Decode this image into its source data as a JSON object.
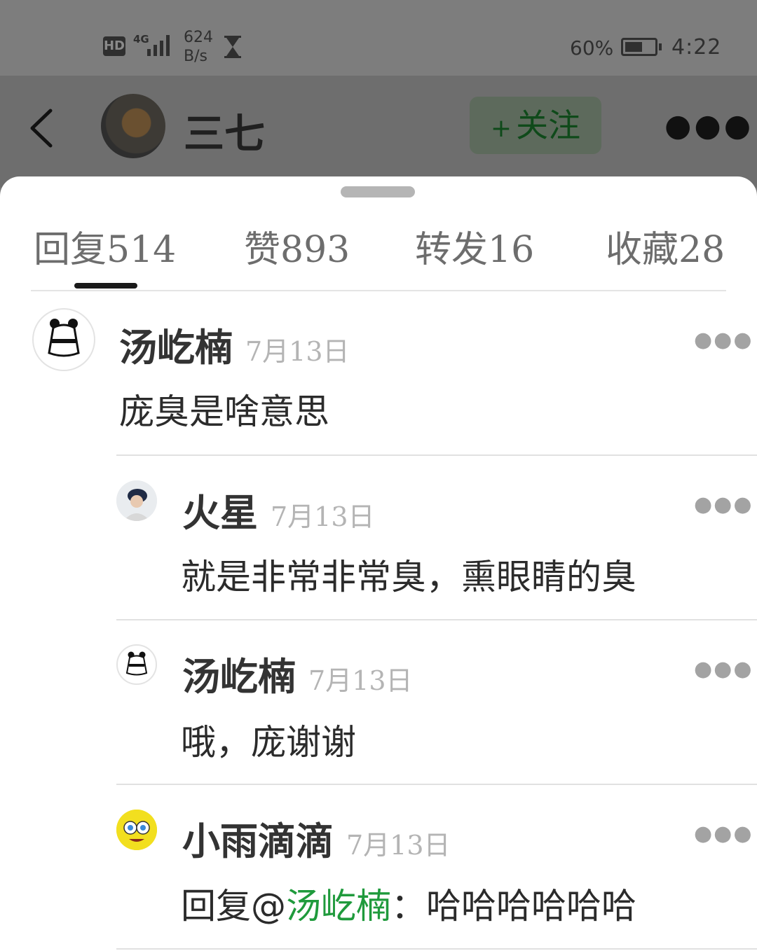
{
  "status_bar": {
    "hd": "HD",
    "network": "4G",
    "speed_value": "624",
    "speed_unit": "B/s",
    "battery_pct": "60%",
    "battery_level": 0.6,
    "time": "4:22"
  },
  "header": {
    "user_name": "三七",
    "follow_plus": "+",
    "follow_label": "关注",
    "more_icon": "more-dots-icon"
  },
  "tabs": [
    {
      "label": "回复",
      "count": "514"
    },
    {
      "label": "赞",
      "count": "893"
    },
    {
      "label": "转发",
      "count": "16"
    },
    {
      "label": "收藏",
      "count": "28"
    }
  ],
  "comments": [
    {
      "user": "汤屹楠",
      "date": "7月13日",
      "text": "庞臭是啥意思"
    },
    {
      "user": "火星",
      "date": "7月13日",
      "text": "就是非常非常臭，熏眼睛的臭"
    },
    {
      "user": "汤屹楠",
      "date": "7月13日",
      "text": "哦，庞谢谢"
    },
    {
      "user": "小雨滴滴",
      "date": "7月13日",
      "reply_prefix": "回复@",
      "reply_to": "汤屹楠",
      "reply_text": "：哈哈哈哈哈哈"
    }
  ],
  "colors": {
    "accent_green": "#1f9a3c"
  }
}
